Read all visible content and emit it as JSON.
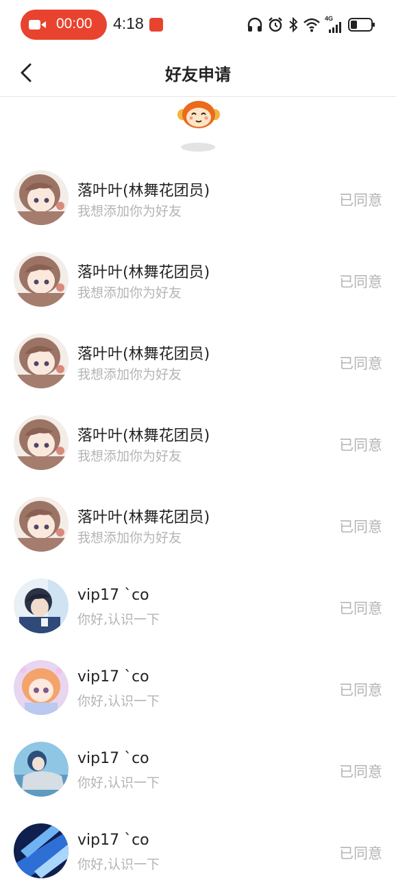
{
  "status_bar": {
    "record_time": "00:00",
    "clock": "4:18",
    "network": "4G"
  },
  "header": {
    "title": "好友申请"
  },
  "colors": {
    "record_pill": "#e8432e",
    "muted_text": "#b4b4b4",
    "primary_text": "#222222",
    "divider": "#e6e6e6"
  },
  "requests": [
    {
      "name": "落叶叶(林舞花团员)",
      "message": "我想添加你为好友",
      "status": "已同意",
      "avatar": "anime-girl-brown-hair"
    },
    {
      "name": "落叶叶(林舞花团员)",
      "message": "我想添加你为好友",
      "status": "已同意",
      "avatar": "anime-girl-brown-hair"
    },
    {
      "name": "落叶叶(林舞花团员)",
      "message": "我想添加你为好友",
      "status": "已同意",
      "avatar": "anime-girl-brown-hair"
    },
    {
      "name": "落叶叶(林舞花团员)",
      "message": "我想添加你为好友",
      "status": "已同意",
      "avatar": "anime-girl-brown-hair"
    },
    {
      "name": "落叶叶(林舞花团员)",
      "message": "我想添加你为好友",
      "status": "已同意",
      "avatar": "anime-girl-brown-hair"
    },
    {
      "name": "vip17 `co",
      "message": "你好,认识一下",
      "status": "已同意",
      "avatar": "anime-boy-dark"
    },
    {
      "name": "vip17 `co",
      "message": "你好,认识一下",
      "status": "已同意",
      "avatar": "anime-girl-pink"
    },
    {
      "name": "vip17 `co",
      "message": "你好,认识一下",
      "status": "已同意",
      "avatar": "anime-boy-blue"
    },
    {
      "name": "vip17 `co",
      "message": "你好,认识一下",
      "status": "已同意",
      "avatar": "blue-abstract"
    }
  ]
}
